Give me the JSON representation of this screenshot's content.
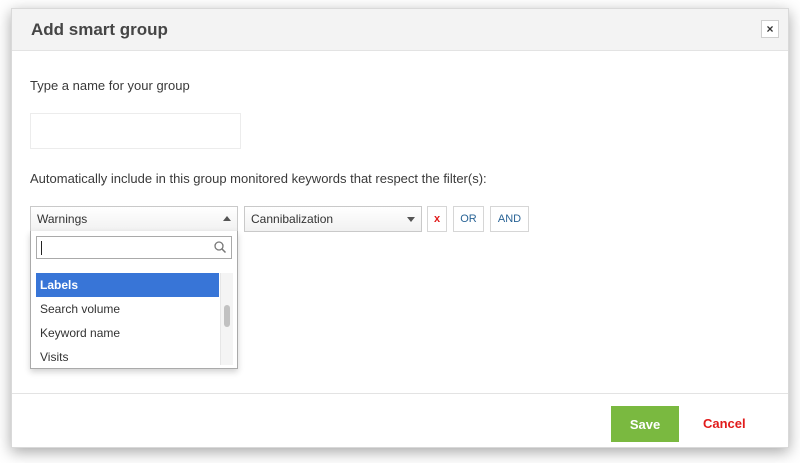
{
  "modal": {
    "title": "Add smart group",
    "close_icon": "×"
  },
  "name_section": {
    "label": "Type a name for your group",
    "input_value": "",
    "input_placeholder": ""
  },
  "filter_section": {
    "label": "Automatically include in this group monitored keywords that respect the filter(s):",
    "field_select": {
      "selected": "Warnings"
    },
    "value_select": {
      "selected": "Cannibalization"
    },
    "remove_label": "x",
    "or_label": "OR",
    "and_label": "AND",
    "dropdown": {
      "search_value": "",
      "items": [
        {
          "label": "Labels",
          "selected": true
        },
        {
          "label": "Search volume",
          "selected": false
        },
        {
          "label": "Keyword name",
          "selected": false
        },
        {
          "label": "Visits",
          "selected": false
        }
      ]
    }
  },
  "footer": {
    "save_label": "Save",
    "cancel_label": "Cancel"
  },
  "colors": {
    "save_green": "#7ab940",
    "cancel_red": "#e11b1b",
    "remove_red": "#e11b1b",
    "link_blue": "#2a6496",
    "selected_blue": "#3875d7"
  }
}
